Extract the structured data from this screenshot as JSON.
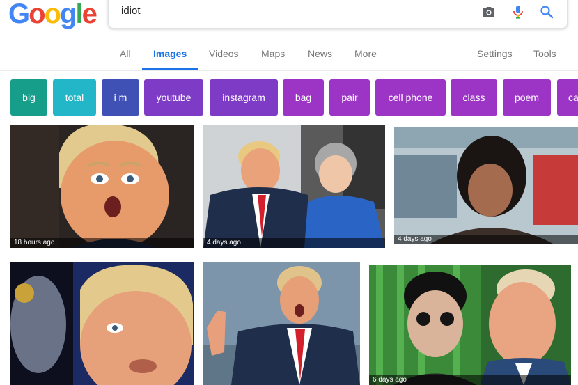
{
  "logo": {
    "letters": [
      "G",
      "o",
      "o",
      "g",
      "l",
      "e"
    ],
    "colors": [
      "#4285F4",
      "#EA4335",
      "#FBBC05",
      "#4285F4",
      "#34A853",
      "#EA4335"
    ]
  },
  "search": {
    "query": "idiot"
  },
  "tabs": [
    {
      "label": "All"
    },
    {
      "label": "Images",
      "active": true
    },
    {
      "label": "Videos"
    },
    {
      "label": "Maps"
    },
    {
      "label": "News"
    },
    {
      "label": "More"
    },
    {
      "label": "Settings"
    },
    {
      "label": "Tools"
    }
  ],
  "chips": [
    {
      "label": "big",
      "color": "#179e8a"
    },
    {
      "label": "total",
      "color": "#23b6c9"
    },
    {
      "label": "i m",
      "color": "#3f51b5"
    },
    {
      "label": "youtube",
      "color": "#7e3cc6"
    },
    {
      "label": "instagram",
      "color": "#7e3cc6"
    },
    {
      "label": "bag",
      "color": "#9c35c6"
    },
    {
      "label": "pair",
      "color": "#9c35c6"
    },
    {
      "label": "cell phone",
      "color": "#9c35c6"
    },
    {
      "label": "class",
      "color": "#9c35c6"
    },
    {
      "label": "poem",
      "color": "#9c35c6"
    },
    {
      "label": "ca",
      "color": "#9c35c6"
    }
  ],
  "results": [
    {
      "timestamp": "18 hours ago"
    },
    {
      "timestamp": "4 days ago"
    },
    {
      "timestamp": "4 days ago"
    },
    {
      "timestamp": ""
    },
    {
      "timestamp": ""
    },
    {
      "timestamp": "6 days ago"
    }
  ]
}
